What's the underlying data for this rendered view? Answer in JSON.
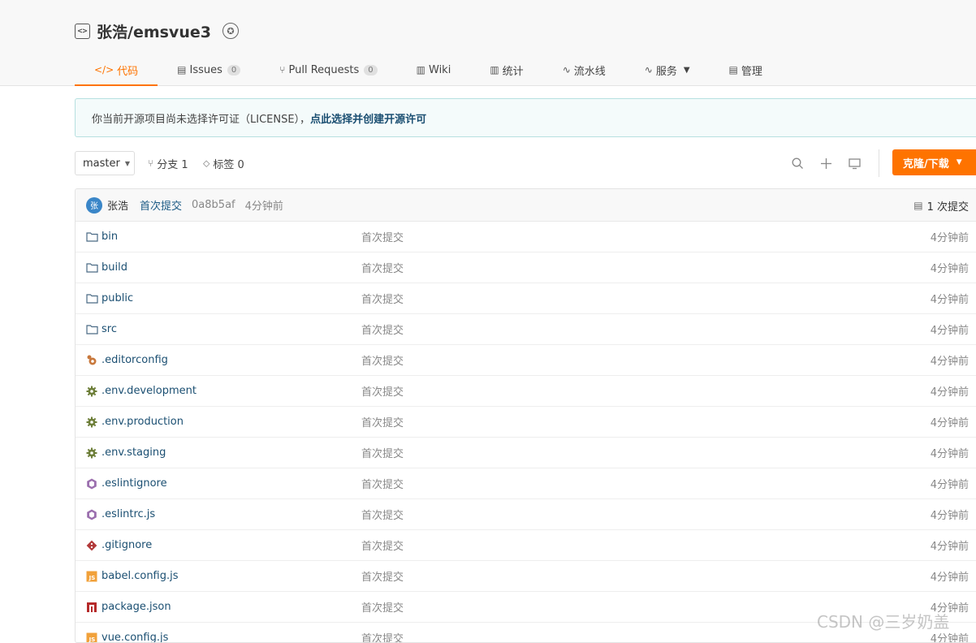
{
  "repo": {
    "title": "张浩/emsvue3"
  },
  "tabs": [
    {
      "label": "代码",
      "icon": "code-icon",
      "glyph": "</>",
      "active": true
    },
    {
      "label": "Issues",
      "icon": "issues-icon",
      "glyph": "▤",
      "count": "0"
    },
    {
      "label": "Pull Requests",
      "icon": "pull-request-icon",
      "glyph": "⑂",
      "count": "0"
    },
    {
      "label": "Wiki",
      "icon": "wiki-icon",
      "glyph": "▥"
    },
    {
      "label": "统计",
      "icon": "stats-icon",
      "glyph": "▥"
    },
    {
      "label": "流水线",
      "icon": "pipeline-icon",
      "glyph": "∿"
    },
    {
      "label": "服务",
      "icon": "service-icon",
      "glyph": "∿",
      "dropdown": true
    },
    {
      "label": "管理",
      "icon": "manage-icon",
      "glyph": "▤"
    }
  ],
  "notice": {
    "text": "你当前开源项目尚未选择许可证（LICENSE），",
    "link": "点此选择并创建开源许可"
  },
  "toolbar": {
    "branch": "master",
    "branches_label": "分支 1",
    "tags_label": "标签 0",
    "clone_label": "克隆/下载"
  },
  "commit": {
    "avatar_text": "张",
    "author": "张浩",
    "message": "首次提交",
    "sha": "0a8b5af",
    "time": "4分钟前",
    "count_label": "1 次提交"
  },
  "files": [
    {
      "name": "bin",
      "type": "folder",
      "icon": "folder-icon",
      "message": "首次提交",
      "time": "4分钟前"
    },
    {
      "name": "build",
      "type": "folder",
      "icon": "folder-icon",
      "message": "首次提交",
      "time": "4分钟前"
    },
    {
      "name": "public",
      "type": "folder",
      "icon": "folder-icon",
      "message": "首次提交",
      "time": "4分钟前"
    },
    {
      "name": "src",
      "type": "folder",
      "icon": "folder-icon",
      "message": "首次提交",
      "time": "4分钟前"
    },
    {
      "name": ".editorconfig",
      "type": "file",
      "icon": "editorconfig-icon",
      "message": "首次提交",
      "time": "4分钟前"
    },
    {
      "name": ".env.development",
      "type": "file",
      "icon": "gear-icon",
      "message": "首次提交",
      "time": "4分钟前"
    },
    {
      "name": ".env.production",
      "type": "file",
      "icon": "gear-icon",
      "message": "首次提交",
      "time": "4分钟前"
    },
    {
      "name": ".env.staging",
      "type": "file",
      "icon": "gear-icon",
      "message": "首次提交",
      "time": "4分钟前"
    },
    {
      "name": ".eslintignore",
      "type": "file",
      "icon": "eslint-icon",
      "message": "首次提交",
      "time": "4分钟前"
    },
    {
      "name": ".eslintrc.js",
      "type": "file",
      "icon": "eslint-icon",
      "message": "首次提交",
      "time": "4分钟前"
    },
    {
      "name": ".gitignore",
      "type": "file",
      "icon": "git-icon",
      "message": "首次提交",
      "time": "4分钟前"
    },
    {
      "name": "babel.config.js",
      "type": "file",
      "icon": "js-icon",
      "message": "首次提交",
      "time": "4分钟前"
    },
    {
      "name": "package.json",
      "type": "file",
      "icon": "npm-icon",
      "message": "首次提交",
      "time": "4分钟前"
    },
    {
      "name": "vue.config.js",
      "type": "file",
      "icon": "js-icon",
      "message": "首次提交",
      "time": "4分钟前"
    }
  ],
  "watermark": "CSDN @三岁奶盖",
  "colors": {
    "accent": "#fe7300",
    "link": "#1b4f72"
  }
}
